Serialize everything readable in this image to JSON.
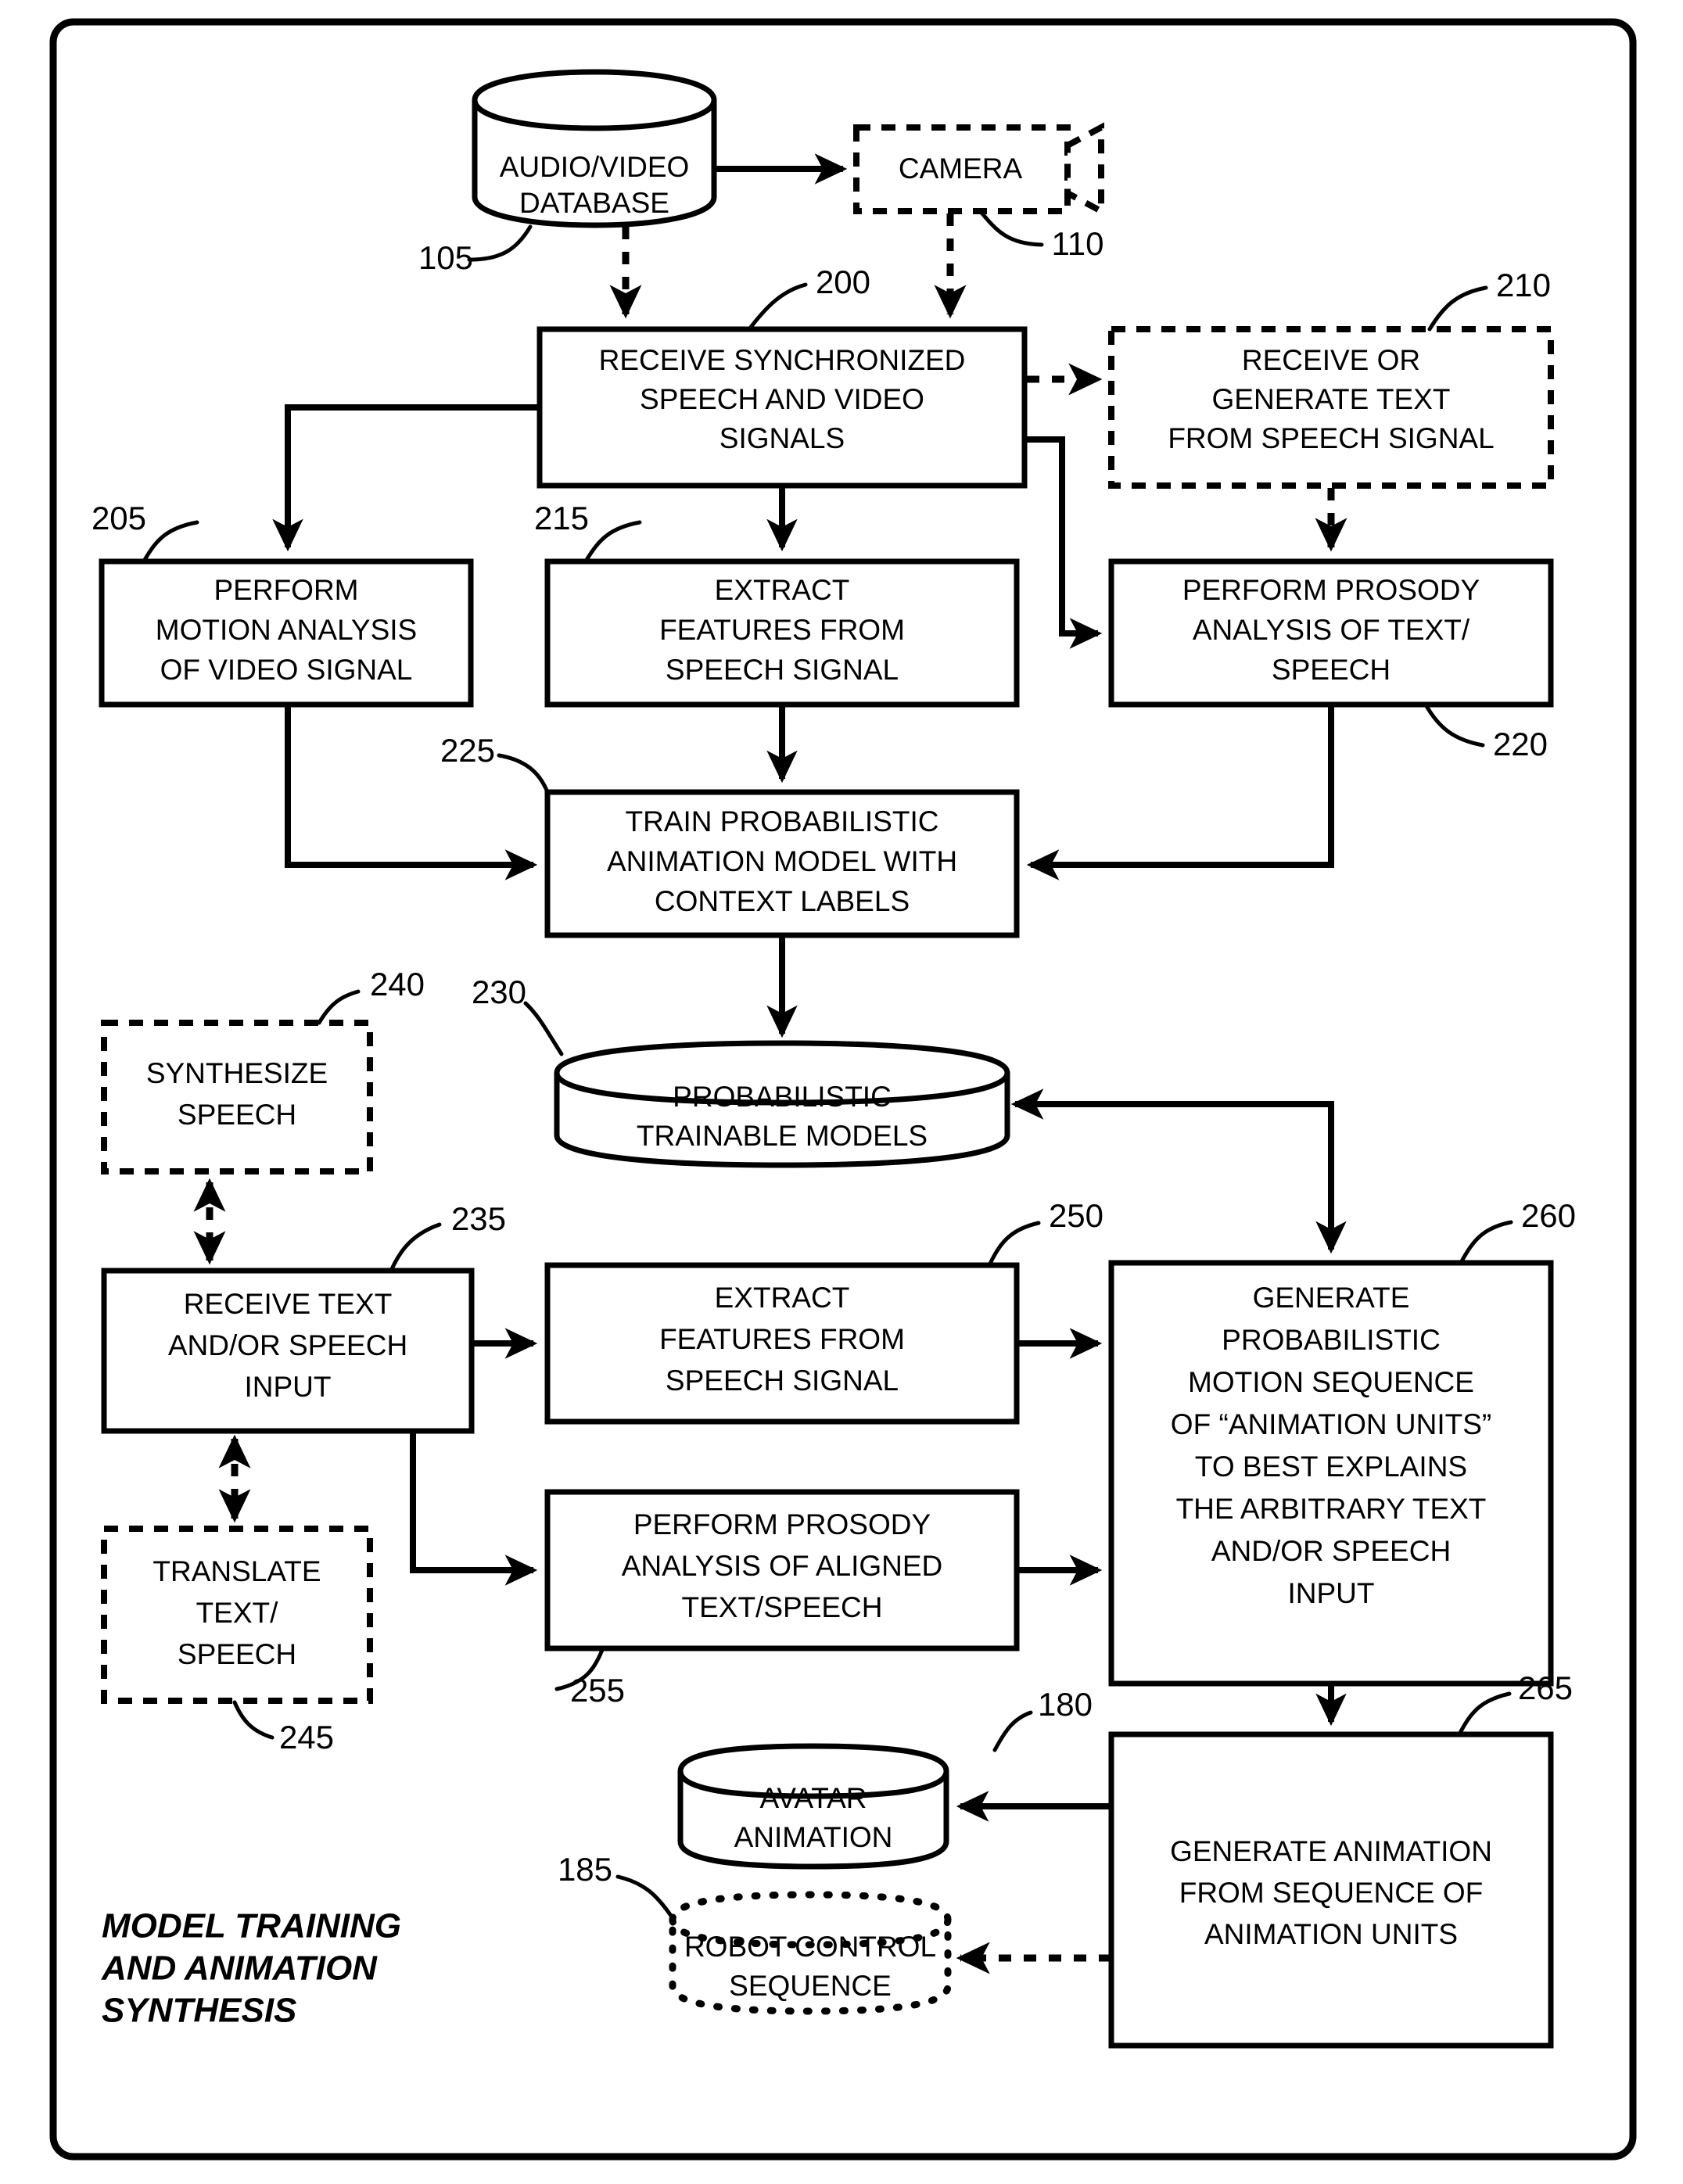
{
  "figure": {
    "title": [
      "MODEL TRAINING",
      "AND ANIMATION",
      "SYNTHESIS"
    ],
    "title_full": "MODEL TRAINING AND ANIMATION SYNTHESIS",
    "accent_color": "#000000",
    "background_color": "#ffffff"
  },
  "nodes": {
    "n105": {
      "ref": "105",
      "shape": "cylinder",
      "style": "solid",
      "lines": [
        "AUDIO/VIDEO",
        "DATABASE"
      ]
    },
    "n110": {
      "ref": "110",
      "shape": "camera",
      "style": "dashed",
      "lines": [
        "CAMERA"
      ]
    },
    "n200": {
      "ref": "200",
      "shape": "rect",
      "style": "solid",
      "lines": [
        "RECEIVE SYNCHRONIZED",
        "SPEECH AND VIDEO",
        "SIGNALS"
      ]
    },
    "n210": {
      "ref": "210",
      "shape": "rect",
      "style": "dashed",
      "lines": [
        "RECEIVE OR",
        "GENERATE TEXT",
        "FROM SPEECH SIGNAL"
      ]
    },
    "n205": {
      "ref": "205",
      "shape": "rect",
      "style": "solid",
      "lines": [
        "PERFORM",
        "MOTION ANALYSIS",
        "OF VIDEO SIGNAL"
      ]
    },
    "n215": {
      "ref": "215",
      "shape": "rect",
      "style": "solid",
      "lines": [
        "EXTRACT",
        "FEATURES FROM",
        "SPEECH SIGNAL"
      ]
    },
    "n220": {
      "ref": "220",
      "shape": "rect",
      "style": "solid",
      "lines": [
        "PERFORM PROSODY",
        "ANALYSIS OF TEXT/",
        "SPEECH"
      ]
    },
    "n225": {
      "ref": "225",
      "shape": "rect",
      "style": "solid",
      "lines": [
        "TRAIN PROBABILISTIC",
        "ANIMATION MODEL WITH",
        "CONTEXT LABELS"
      ]
    },
    "n230": {
      "ref": "230",
      "shape": "cylinder",
      "style": "solid",
      "lines": [
        "PROBABILISTIC",
        "TRAINABLE MODELS"
      ]
    },
    "n240": {
      "ref": "240",
      "shape": "rect",
      "style": "dashed",
      "lines": [
        "SYNTHESIZE",
        "SPEECH"
      ]
    },
    "n235": {
      "ref": "235",
      "shape": "rect",
      "style": "solid",
      "lines": [
        "RECEIVE TEXT",
        "AND/OR SPEECH",
        "INPUT"
      ]
    },
    "n245": {
      "ref": "245",
      "shape": "rect",
      "style": "dashed",
      "lines": [
        "TRANSLATE",
        "TEXT/",
        "SPEECH"
      ]
    },
    "n250": {
      "ref": "250",
      "shape": "rect",
      "style": "solid",
      "lines": [
        "EXTRACT",
        "FEATURES FROM",
        "SPEECH SIGNAL"
      ]
    },
    "n255": {
      "ref": "255",
      "shape": "rect",
      "style": "solid",
      "lines": [
        "PERFORM PROSODY",
        "ANALYSIS OF ALIGNED",
        "TEXT/SPEECH"
      ]
    },
    "n260": {
      "ref": "260",
      "shape": "rect",
      "style": "solid",
      "lines": [
        "GENERATE",
        "PROBABILISTIC",
        "MOTION SEQUENCE",
        "OF “ANIMATION UNITS”",
        "TO BEST EXPLAINS",
        "THE ARBITRARY TEXT",
        "AND/OR SPEECH",
        "INPUT"
      ]
    },
    "n265": {
      "ref": "265",
      "shape": "rect",
      "style": "solid",
      "lines": [
        "GENERATE ANIMATION",
        "FROM SEQUENCE OF",
        "ANIMATION UNITS"
      ]
    },
    "n180": {
      "ref": "180",
      "shape": "cylinder",
      "style": "solid",
      "lines": [
        "AVATAR",
        "ANIMATION"
      ]
    },
    "n185": {
      "ref": "185",
      "shape": "cylinder",
      "style": "dotted",
      "lines": [
        "ROBOT CONTROL",
        "SEQUENCE"
      ]
    }
  },
  "connections": [
    {
      "from": "n105",
      "to": "n110",
      "style": "solid"
    },
    {
      "from": "n105",
      "to": "n200",
      "style": "dashed"
    },
    {
      "from": "n110",
      "to": "n200",
      "style": "dashed"
    },
    {
      "from": "n200",
      "to": "n210",
      "style": "dashed"
    },
    {
      "from": "n200",
      "to": "n205",
      "style": "solid"
    },
    {
      "from": "n200",
      "to": "n215",
      "style": "solid"
    },
    {
      "from": "n200",
      "to": "n220",
      "style": "solid"
    },
    {
      "from": "n210",
      "to": "n220",
      "style": "dashed"
    },
    {
      "from": "n205",
      "to": "n225",
      "style": "solid"
    },
    {
      "from": "n215",
      "to": "n225",
      "style": "solid"
    },
    {
      "from": "n220",
      "to": "n225",
      "style": "solid"
    },
    {
      "from": "n225",
      "to": "n230",
      "style": "solid"
    },
    {
      "from": "n240",
      "to": "n235",
      "style": "dashed-bidirectional"
    },
    {
      "from": "n235",
      "to": "n245",
      "style": "dashed-bidirectional"
    },
    {
      "from": "n235",
      "to": "n250",
      "style": "solid"
    },
    {
      "from": "n235",
      "to": "n255",
      "style": "solid"
    },
    {
      "from": "n250",
      "to": "n260",
      "style": "solid"
    },
    {
      "from": "n255",
      "to": "n260",
      "style": "solid"
    },
    {
      "from": "n230",
      "to": "n260",
      "style": "solid"
    },
    {
      "from": "n260",
      "to": "n265",
      "style": "solid"
    },
    {
      "from": "n265",
      "to": "n180",
      "style": "solid"
    },
    {
      "from": "n265",
      "to": "n185",
      "style": "dashed"
    }
  ]
}
